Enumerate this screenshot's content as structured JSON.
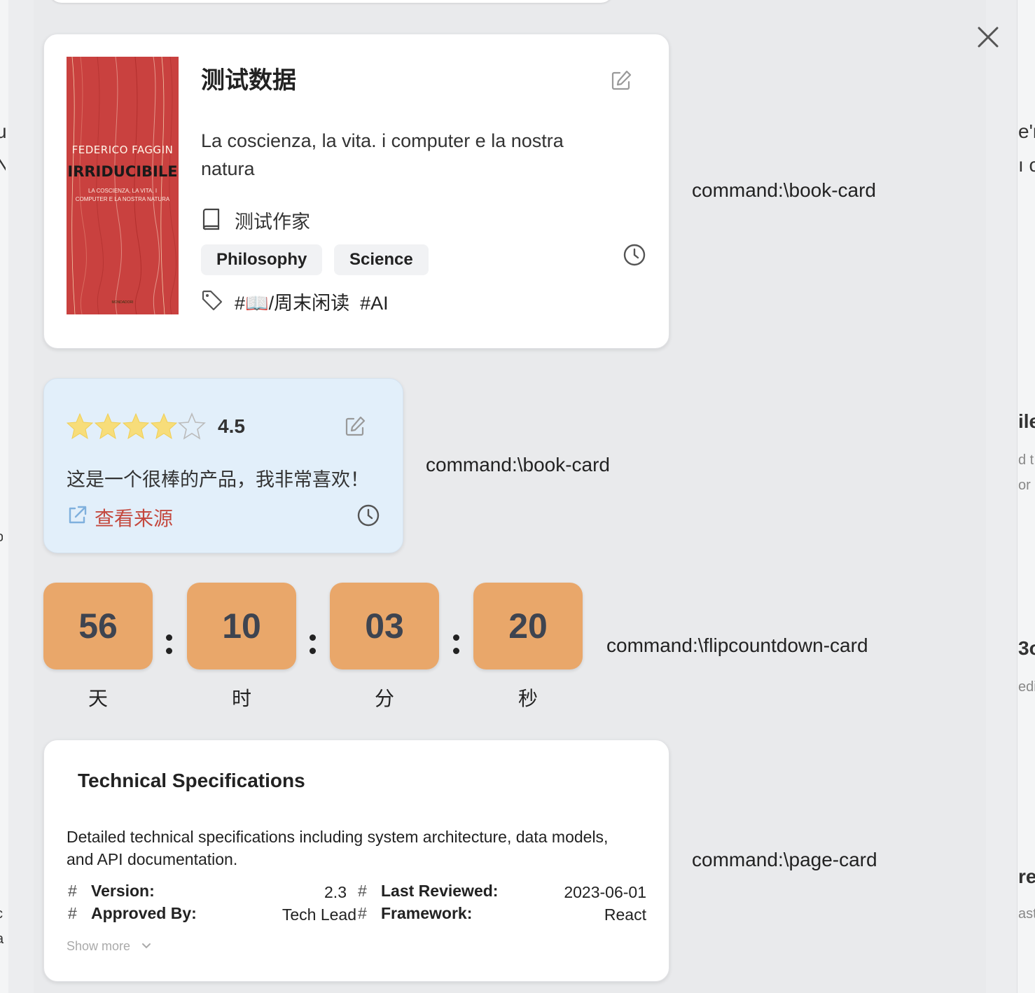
{
  "peeks": {
    "left": [
      "u",
      "N",
      ")",
      "o",
      "c",
      "a"
    ],
    "right": [
      "e'r",
      "ı c",
      "ile",
      "d t",
      "or",
      "3o",
      "edi",
      "re",
      "ast"
    ]
  },
  "book_card": {
    "title": "测试数据",
    "subtitle": "La coscienza, la vita. i computer e la nostra natura",
    "author": "测试作家",
    "categories": [
      "Philosophy",
      "Science"
    ],
    "tags": "#📖/周末闲读  #AI",
    "cover": {
      "author": "FEDERICO FAGGIN",
      "title": "IRRIDUCIBILE",
      "subtitle": "LA COSCIENZA, LA VITA, I COMPUTER E LA NOSTRA NATURA",
      "publisher": "MONDADORI"
    },
    "command": "command:\\book-card"
  },
  "review_card": {
    "rating": "4.5",
    "rating_value": 4.5,
    "rating_max": 5,
    "text": "这是一个很棒的产品，我非常喜欢！",
    "source_label": "查看来源",
    "command": "command:\\book-card"
  },
  "countdown": {
    "units": [
      {
        "value": "56",
        "label": "天"
      },
      {
        "value": "10",
        "label": "时"
      },
      {
        "value": "03",
        "label": "分"
      },
      {
        "value": "20",
        "label": "秒"
      }
    ],
    "command": "command:\\flipcountdown-card"
  },
  "page_card": {
    "title": "Technical Specifications",
    "description": "Detailed technical specifications including system architecture, data models, and API documentation.",
    "meta": [
      {
        "key": "Version:",
        "value": "2.3"
      },
      {
        "key": "Last Reviewed:",
        "value": "2023-06-01"
      },
      {
        "key": "Approved By:",
        "value": "Tech Lead"
      },
      {
        "key": "Framework:",
        "value": "React"
      }
    ],
    "show_more": "Show more",
    "command": "command:\\page-card"
  },
  "colors": {
    "countdown_box": "#e9a76a",
    "review_bg": "#e2effa",
    "star": "#f7dd7a",
    "link": "#c4493f",
    "cover": "#c9413f"
  }
}
